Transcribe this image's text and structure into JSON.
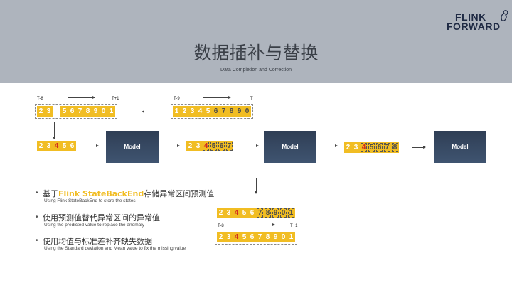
{
  "header": {
    "title": "数据插补与替换",
    "subtitle": "Data Completion and Correction",
    "logo_line1": "FLINK",
    "logo_line2": "FORWARD"
  },
  "colors": {
    "accent": "#f1bd23",
    "highlight": "#d22a1e",
    "model": "#2f3e55",
    "header_bg": "#aeb4bd"
  },
  "top_left": {
    "start_label": "T-8",
    "end_label": "T+1",
    "cells": [
      "2",
      "3",
      "",
      "5",
      "6",
      "7",
      "8",
      "9",
      "0",
      "1"
    ]
  },
  "top_mid": {
    "start_label": "T-9",
    "end_label": "T",
    "cells": [
      "1",
      "2",
      "3",
      "4",
      "5",
      "6",
      "7",
      "8",
      "9",
      "0"
    ]
  },
  "row2": {
    "seq_a": [
      "2",
      "3",
      "4",
      "5",
      "6"
    ],
    "seq_b": [
      "2",
      "3",
      "4",
      "5",
      "6",
      "7"
    ],
    "seq_c": [
      "2",
      "3",
      "4",
      "5",
      "6",
      "7",
      "8"
    ],
    "model_labels": [
      "Model",
      "Model",
      "Model"
    ]
  },
  "bullets": [
    {
      "zh_pre": "基于",
      "zh_hl": "Flink StateBackEnd",
      "zh_post": "存储异常区间预测值",
      "en": "Using Flink StateBackEnd to store the states"
    },
    {
      "zh_pre": "使用预测值替代异常区间的异常值",
      "zh_hl": "",
      "zh_post": "",
      "en": "Using the predicted value to replace the anomaly"
    },
    {
      "zh_pre": "使用均值与标准差补齐缺失数据",
      "zh_hl": "",
      "zh_post": "",
      "en": "Using the Standard deviation and Mean value to fix the missing value"
    }
  ],
  "bottom": {
    "seq_a": [
      "2",
      "3",
      "4",
      "5",
      "6",
      "7",
      "8",
      "9",
      "0",
      "1"
    ],
    "seq_b": [
      "2",
      "3",
      "4",
      "5",
      "6",
      "7",
      "8",
      "9",
      "0",
      "1"
    ],
    "start_label": "T-8",
    "end_label": "T+1"
  }
}
